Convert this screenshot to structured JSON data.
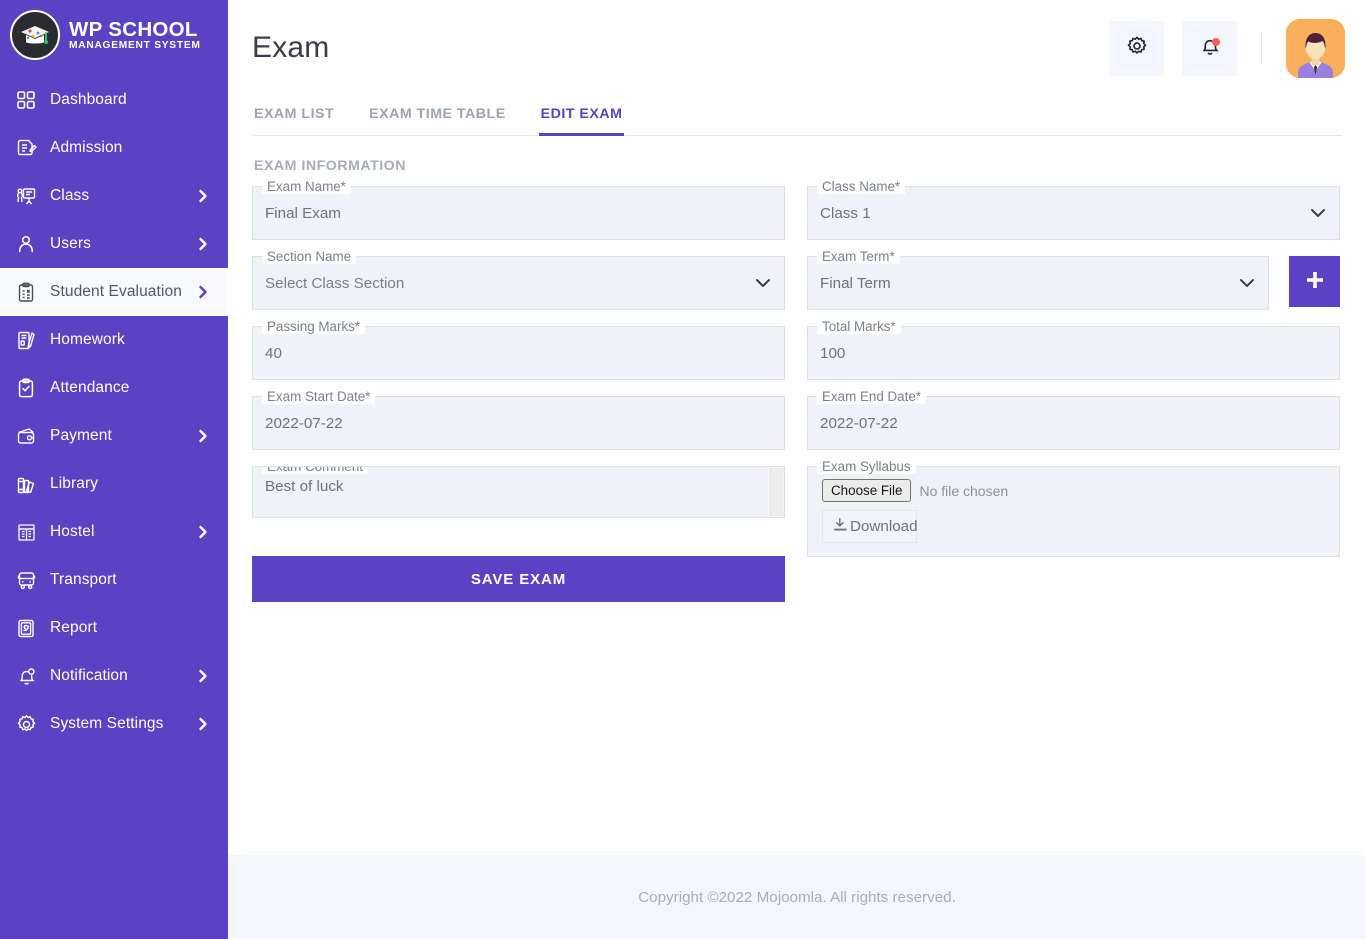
{
  "brand": {
    "title": "WP SCHOOL",
    "subtitle": "MANAGEMENT SYSTEM",
    "logo_icon": "graduation-cap-logo"
  },
  "sidebar": {
    "items": [
      {
        "label": "Dashboard",
        "icon": "grid-icon",
        "has_chevron": false,
        "active": false
      },
      {
        "label": "Admission",
        "icon": "document-edit-icon",
        "has_chevron": false,
        "active": false
      },
      {
        "label": "Class",
        "icon": "classroom-icon",
        "has_chevron": true,
        "active": false
      },
      {
        "label": "Users",
        "icon": "user-icon",
        "has_chevron": true,
        "active": false
      },
      {
        "label": "Student Evaluation",
        "icon": "clipboard-check-icon",
        "has_chevron": true,
        "active": true
      },
      {
        "label": "Homework",
        "icon": "homework-icon",
        "has_chevron": false,
        "active": false
      },
      {
        "label": "Attendance",
        "icon": "clipboard-tick-icon",
        "has_chevron": false,
        "active": false
      },
      {
        "label": "Payment",
        "icon": "wallet-icon",
        "has_chevron": true,
        "active": false
      },
      {
        "label": "Library",
        "icon": "books-icon",
        "has_chevron": false,
        "active": false
      },
      {
        "label": "Hostel",
        "icon": "hostel-icon",
        "has_chevron": true,
        "active": false
      },
      {
        "label": "Transport",
        "icon": "bus-icon",
        "has_chevron": false,
        "active": false
      },
      {
        "label": "Report",
        "icon": "report-icon",
        "has_chevron": false,
        "active": false
      },
      {
        "label": "Notification",
        "icon": "bell-icon",
        "has_chevron": true,
        "active": false
      },
      {
        "label": "System Settings",
        "icon": "gear-icon",
        "has_chevron": true,
        "active": false
      }
    ]
  },
  "header": {
    "title": "Exam",
    "settings_icon": "gear-icon",
    "notification_icon": "bell-icon",
    "has_notification_dot": true,
    "avatar_icon": "user-avatar"
  },
  "tabs": [
    {
      "label": "EXAM LIST",
      "active": false
    },
    {
      "label": "EXAM TIME TABLE",
      "active": false
    },
    {
      "label": "EDIT EXAM",
      "active": true
    }
  ],
  "form": {
    "section_title": "EXAM INFORMATION",
    "exam_name": {
      "label": "Exam Name*",
      "value": "Final Exam"
    },
    "class_name": {
      "label": "Class Name*",
      "value": "Class 1",
      "type": "select"
    },
    "section_name": {
      "label": "Section Name",
      "value": "Select Class Section",
      "type": "select"
    },
    "exam_term": {
      "label": "Exam Term*",
      "value": "Final Term",
      "type": "select"
    },
    "passing_marks": {
      "label": "Passing Marks*",
      "value": "40"
    },
    "total_marks": {
      "label": "Total Marks*",
      "value": "100"
    },
    "exam_start_date": {
      "label": "Exam Start Date*",
      "value": "2022-07-22"
    },
    "exam_end_date": {
      "label": "Exam End Date*",
      "value": "2022-07-22"
    },
    "exam_comment": {
      "label": "Exam Comment",
      "value": "Best of luck"
    },
    "exam_syllabus": {
      "label": "Exam Syllabus",
      "choose_file_label": "Choose File",
      "file_status": "No file chosen",
      "download_label": "Download",
      "download_icon": "download-icon"
    },
    "add_term_button": {
      "label": "+",
      "icon": "plus-icon"
    },
    "save_button": "SAVE EXAM"
  },
  "footer": {
    "text": "Copyright ©2022 Mojoomla. All rights reserved."
  },
  "colors": {
    "sidebar": "#5942c4",
    "accent": "#5942c4",
    "field_bg": "#eff3f8",
    "footer_bg": "#f3f6fb",
    "notification_dot": "#ff5d52",
    "avatar_bg": "#f8b05a"
  }
}
